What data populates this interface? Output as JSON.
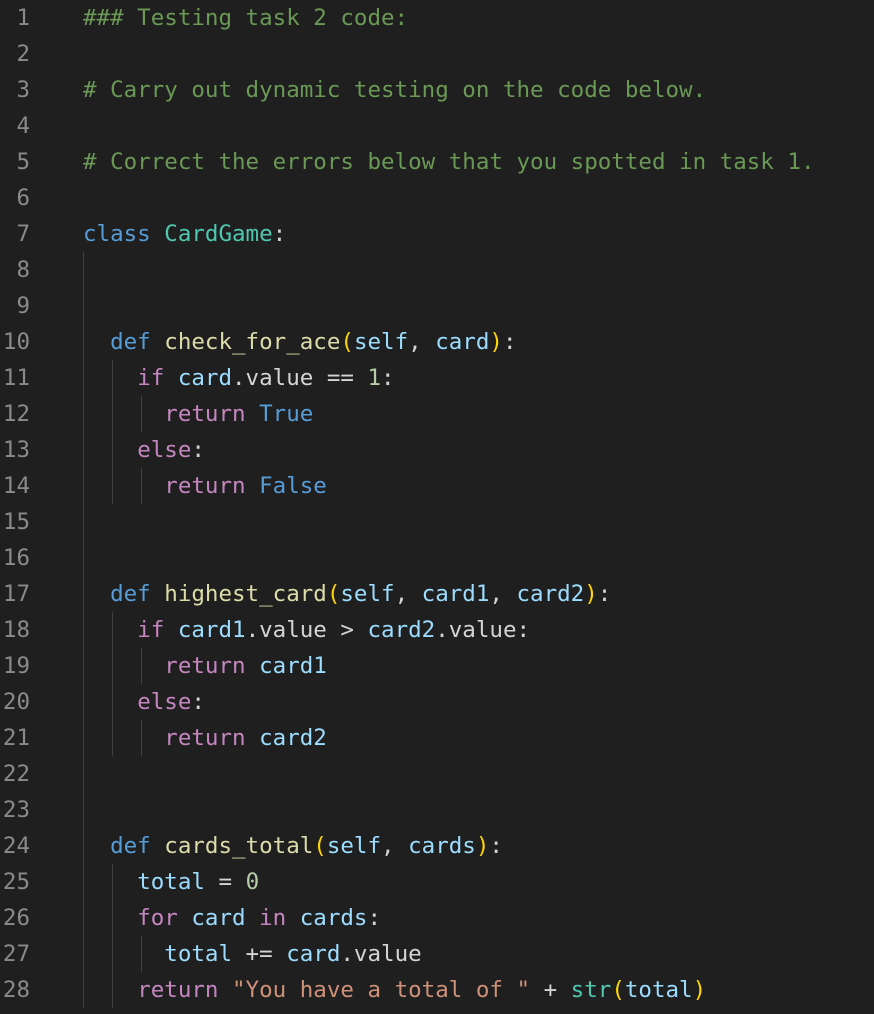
{
  "colors": {
    "background": "#1f1f1f",
    "line_number": "#8a8a8a",
    "default": "#d4d4d4",
    "comment": "#6a9955",
    "keyword_storage": "#569cd6",
    "keyword_control": "#c586c0",
    "function": "#dcdcaa",
    "class_name": "#4ec9b0",
    "variable": "#9cdcfe",
    "number": "#b5cea8",
    "string": "#ce9178",
    "bracket": "#ffd700",
    "constant": "#569cd6",
    "indent_guide": "#404040"
  },
  "lines": [
    {
      "num": "1",
      "tokens": [
        {
          "t": "### Testing task 2 code:",
          "c": "comment"
        }
      ]
    },
    {
      "num": "2",
      "tokens": []
    },
    {
      "num": "3",
      "tokens": [
        {
          "t": "# Carry out dynamic testing on the code below.",
          "c": "comment"
        }
      ]
    },
    {
      "num": "4",
      "tokens": []
    },
    {
      "num": "5",
      "tokens": [
        {
          "t": "# Correct the errors below that you spotted in task 1.",
          "c": "comment"
        }
      ]
    },
    {
      "num": "6",
      "tokens": []
    },
    {
      "num": "7",
      "tokens": [
        {
          "t": "class",
          "c": "keyword_storage"
        },
        {
          "t": " ",
          "c": "default"
        },
        {
          "t": "CardGame",
          "c": "class_name"
        },
        {
          "t": ":",
          "c": "default"
        }
      ]
    },
    {
      "num": "8",
      "tokens": []
    },
    {
      "num": "9",
      "tokens": []
    },
    {
      "num": "10",
      "tokens": [
        {
          "t": "  ",
          "c": "default"
        },
        {
          "t": "def",
          "c": "keyword_storage"
        },
        {
          "t": " ",
          "c": "default"
        },
        {
          "t": "check_for_ace",
          "c": "function"
        },
        {
          "t": "(",
          "c": "bracket"
        },
        {
          "t": "self",
          "c": "variable"
        },
        {
          "t": ", ",
          "c": "default"
        },
        {
          "t": "card",
          "c": "variable"
        },
        {
          "t": ")",
          "c": "bracket"
        },
        {
          "t": ":",
          "c": "default"
        }
      ]
    },
    {
      "num": "11",
      "tokens": [
        {
          "t": "    ",
          "c": "default"
        },
        {
          "t": "if",
          "c": "keyword_control"
        },
        {
          "t": " ",
          "c": "default"
        },
        {
          "t": "card",
          "c": "variable"
        },
        {
          "t": ".value == ",
          "c": "default"
        },
        {
          "t": "1",
          "c": "number"
        },
        {
          "t": ":",
          "c": "default"
        }
      ]
    },
    {
      "num": "12",
      "tokens": [
        {
          "t": "      ",
          "c": "default"
        },
        {
          "t": "return",
          "c": "keyword_control"
        },
        {
          "t": " ",
          "c": "default"
        },
        {
          "t": "True",
          "c": "constant"
        }
      ]
    },
    {
      "num": "13",
      "tokens": [
        {
          "t": "    ",
          "c": "default"
        },
        {
          "t": "else",
          "c": "keyword_control"
        },
        {
          "t": ":",
          "c": "default"
        }
      ]
    },
    {
      "num": "14",
      "tokens": [
        {
          "t": "      ",
          "c": "default"
        },
        {
          "t": "return",
          "c": "keyword_control"
        },
        {
          "t": " ",
          "c": "default"
        },
        {
          "t": "False",
          "c": "constant"
        }
      ]
    },
    {
      "num": "15",
      "tokens": []
    },
    {
      "num": "16",
      "tokens": []
    },
    {
      "num": "17",
      "tokens": [
        {
          "t": "  ",
          "c": "default"
        },
        {
          "t": "def",
          "c": "keyword_storage"
        },
        {
          "t": " ",
          "c": "default"
        },
        {
          "t": "highest_card",
          "c": "function"
        },
        {
          "t": "(",
          "c": "bracket"
        },
        {
          "t": "self",
          "c": "variable"
        },
        {
          "t": ", ",
          "c": "default"
        },
        {
          "t": "card1",
          "c": "variable"
        },
        {
          "t": ", ",
          "c": "default"
        },
        {
          "t": "card2",
          "c": "variable"
        },
        {
          "t": ")",
          "c": "bracket"
        },
        {
          "t": ":",
          "c": "default"
        }
      ]
    },
    {
      "num": "18",
      "tokens": [
        {
          "t": "    ",
          "c": "default"
        },
        {
          "t": "if",
          "c": "keyword_control"
        },
        {
          "t": " ",
          "c": "default"
        },
        {
          "t": "card1",
          "c": "variable"
        },
        {
          "t": ".value > ",
          "c": "default"
        },
        {
          "t": "card2",
          "c": "variable"
        },
        {
          "t": ".value:",
          "c": "default"
        }
      ]
    },
    {
      "num": "19",
      "tokens": [
        {
          "t": "      ",
          "c": "default"
        },
        {
          "t": "return",
          "c": "keyword_control"
        },
        {
          "t": " ",
          "c": "default"
        },
        {
          "t": "card1",
          "c": "variable"
        }
      ]
    },
    {
      "num": "20",
      "tokens": [
        {
          "t": "    ",
          "c": "default"
        },
        {
          "t": "else",
          "c": "keyword_control"
        },
        {
          "t": ":",
          "c": "default"
        }
      ]
    },
    {
      "num": "21",
      "tokens": [
        {
          "t": "      ",
          "c": "default"
        },
        {
          "t": "return",
          "c": "keyword_control"
        },
        {
          "t": " ",
          "c": "default"
        },
        {
          "t": "card2",
          "c": "variable"
        }
      ]
    },
    {
      "num": "22",
      "tokens": []
    },
    {
      "num": "23",
      "tokens": []
    },
    {
      "num": "24",
      "tokens": [
        {
          "t": "  ",
          "c": "default"
        },
        {
          "t": "def",
          "c": "keyword_storage"
        },
        {
          "t": " ",
          "c": "default"
        },
        {
          "t": "cards_total",
          "c": "function"
        },
        {
          "t": "(",
          "c": "bracket"
        },
        {
          "t": "self",
          "c": "variable"
        },
        {
          "t": ", ",
          "c": "default"
        },
        {
          "t": "cards",
          "c": "variable"
        },
        {
          "t": ")",
          "c": "bracket"
        },
        {
          "t": ":",
          "c": "default"
        }
      ]
    },
    {
      "num": "25",
      "tokens": [
        {
          "t": "    ",
          "c": "default"
        },
        {
          "t": "total",
          "c": "variable"
        },
        {
          "t": " = ",
          "c": "default"
        },
        {
          "t": "0",
          "c": "number"
        }
      ]
    },
    {
      "num": "26",
      "tokens": [
        {
          "t": "    ",
          "c": "default"
        },
        {
          "t": "for",
          "c": "keyword_control"
        },
        {
          "t": " ",
          "c": "default"
        },
        {
          "t": "card",
          "c": "variable"
        },
        {
          "t": " ",
          "c": "default"
        },
        {
          "t": "in",
          "c": "keyword_control"
        },
        {
          "t": " ",
          "c": "default"
        },
        {
          "t": "cards",
          "c": "variable"
        },
        {
          "t": ":",
          "c": "default"
        }
      ]
    },
    {
      "num": "27",
      "tokens": [
        {
          "t": "      ",
          "c": "default"
        },
        {
          "t": "total",
          "c": "variable"
        },
        {
          "t": " += ",
          "c": "default"
        },
        {
          "t": "card",
          "c": "variable"
        },
        {
          "t": ".value",
          "c": "default"
        }
      ]
    },
    {
      "num": "28",
      "tokens": [
        {
          "t": "    ",
          "c": "default"
        },
        {
          "t": "return",
          "c": "keyword_control"
        },
        {
          "t": " ",
          "c": "default"
        },
        {
          "t": "\"You have a total of \"",
          "c": "string"
        },
        {
          "t": " + ",
          "c": "default"
        },
        {
          "t": "str",
          "c": "class_name"
        },
        {
          "t": "(",
          "c": "bracket"
        },
        {
          "t": "total",
          "c": "variable"
        },
        {
          "t": ")",
          "c": "bracket"
        }
      ]
    }
  ]
}
